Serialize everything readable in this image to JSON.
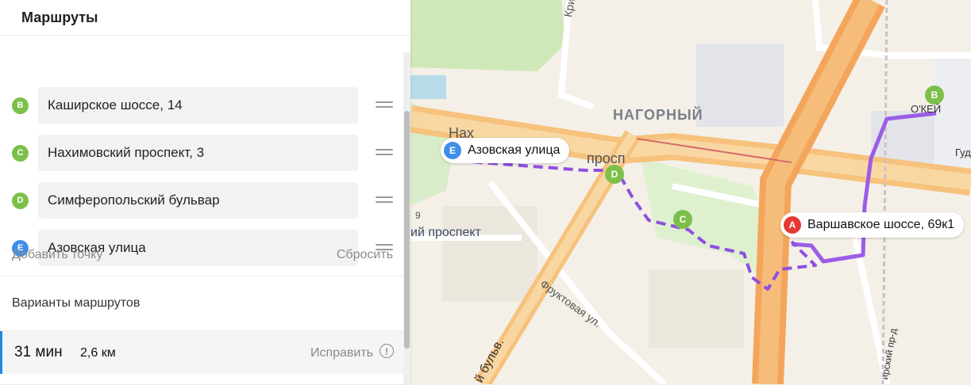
{
  "panel": {
    "title": "Маршруты",
    "waypoints": [
      {
        "letter": "B",
        "label": "Каширское шоссе, 14",
        "color": "#7cc04b"
      },
      {
        "letter": "C",
        "label": "Нахимовский проспект, 3",
        "color": "#7cc04b"
      },
      {
        "letter": "D",
        "label": "Симферопольский бульвар",
        "color": "#7cc04b"
      },
      {
        "letter": "E",
        "label": "Азовская улица",
        "color": "#3f8ee8"
      }
    ],
    "add_point": "Добавить точку",
    "reset": "Сбросить",
    "variants_title": "Варианты маршрутов",
    "route": {
      "time": "31 мин",
      "distance": "2,6 км",
      "fix": "Исправить",
      "warn_icon": "!"
    }
  },
  "map": {
    "district": "НАГОРНЫЙ",
    "pins": [
      {
        "letter": "A",
        "label": "Варшавское шоссе, 69к1",
        "color": "#e53935"
      },
      {
        "letter": "B",
        "color": "#7cc04b"
      },
      {
        "letter": "C",
        "color": "#7cc04b"
      },
      {
        "letter": "D",
        "color": "#7cc04b"
      },
      {
        "letter": "E",
        "label": "Азовская улица",
        "color": "#3f8ee8"
      }
    ],
    "street_labels": {
      "krivorozh": "Криворожская ул.",
      "nakhim": "Нахимовский проспект",
      "nakh_part": "Нах",
      "prosp_part": "просп",
      "fruktovaya": "Фруктовая ул.",
      "bulvar": "й бульв.",
      "ny_prospekt": "ий проспект",
      "nine": "9",
      "o_top": "О'КЕЙ",
      "gud": "Гуд",
      "pr_d": "ирский пр-д"
    },
    "route_colors": {
      "driving": "#9b5ce8",
      "walking": "#8f4fe0"
    }
  }
}
